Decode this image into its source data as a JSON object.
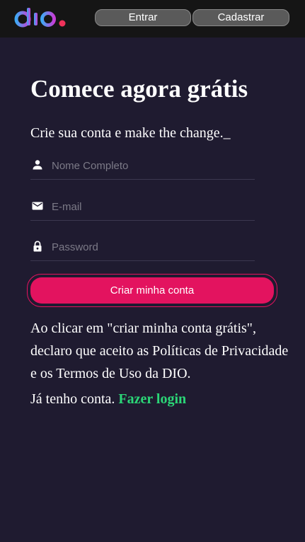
{
  "colors": {
    "background": "#1f1b30",
    "topbar": "#151515",
    "accent_pink": "#e3135f",
    "link_green": "#2bd677",
    "logo_gradient_start": "#3fa9f5",
    "logo_gradient_end": "#c83cd6",
    "logo_dot": "#f0325a"
  },
  "header": {
    "logo": "dio-logo",
    "nav": {
      "entrar_label": "Entrar",
      "cadastrar_label": "Cadastrar"
    }
  },
  "main": {
    "title": "Comece agora grátis",
    "subtitle": "Crie sua conta e make the change._",
    "form": {
      "name": {
        "icon": "person-icon",
        "placeholder": "Nome Completo",
        "value": ""
      },
      "email": {
        "icon": "mail-icon",
        "placeholder": "E-mail",
        "value": ""
      },
      "password": {
        "icon": "lock-icon",
        "placeholder": "Password",
        "value": ""
      },
      "submit_label": "Criar minha conta"
    },
    "terms_text": "Ao clicar em \"criar minha conta grátis\", declaro que aceito as Políticas de Privacidade e os Termos de Uso da DIO.",
    "login_prompt": "Já tenho conta.",
    "login_link": "Fazer login"
  }
}
